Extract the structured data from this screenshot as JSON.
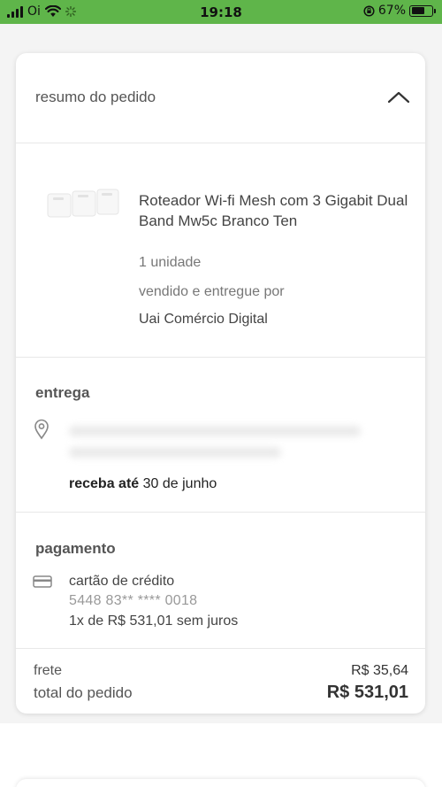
{
  "status_bar": {
    "carrier": "Oi",
    "time": "19:18",
    "battery_percent": "67%",
    "battery_level": 0.67,
    "background_color": "#5fb54a"
  },
  "order_summary": {
    "title": "resumo do pedido",
    "collapse_icon": "chevron-up-icon"
  },
  "product": {
    "name": "Roteador Wi-fi Mesh com 3 Gigabit Dual Band Mw5c Branco Ten",
    "quantity": "1 unidade",
    "sold_by_label": "vendido e entregue por",
    "seller": "Uai Comércio Digital"
  },
  "delivery": {
    "title": "entrega",
    "address_icon": "location-pin-icon",
    "receive_label": "receba até",
    "receive_date": "30 de junho"
  },
  "payment": {
    "title": "pagamento",
    "card_icon": "credit-card-icon",
    "method": "cartão de crédito",
    "card_number": "5448 83** **** 0018",
    "installments": "1x de R$ 531,01 sem juros"
  },
  "totals": {
    "shipping_label": "frete",
    "shipping_value": "R$ 35,64",
    "total_label": "total do pedido",
    "total_value": "R$ 531,01"
  }
}
